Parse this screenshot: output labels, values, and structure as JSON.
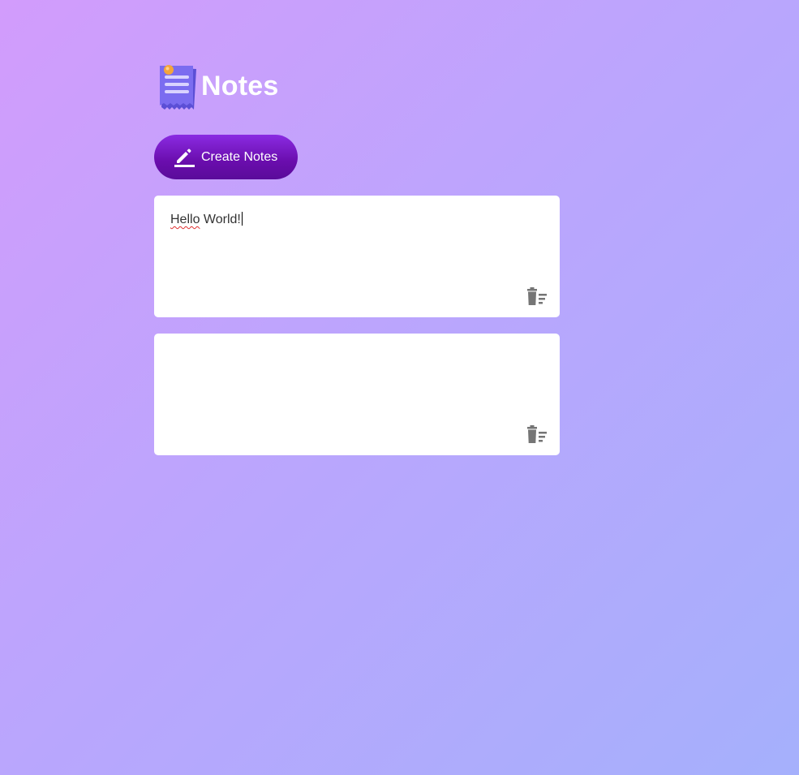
{
  "app": {
    "title": "Notes",
    "logo_icon": "notepad-icon"
  },
  "toolbar": {
    "create_label": "Create Notes",
    "create_icon": "pencil-icon"
  },
  "notes": [
    {
      "word1": "Hello",
      "word2": " World!",
      "has_caret": true,
      "delete_icon": "trash-icon"
    },
    {
      "word1": "",
      "word2": "",
      "has_caret": false,
      "delete_icon": "trash-icon"
    }
  ],
  "colors": {
    "background_start": "#d29cfc",
    "background_end": "#a5b0fc",
    "button_primary": "#7a1fd0",
    "note_background": "#ffffff",
    "icon_gray": "#757575"
  }
}
